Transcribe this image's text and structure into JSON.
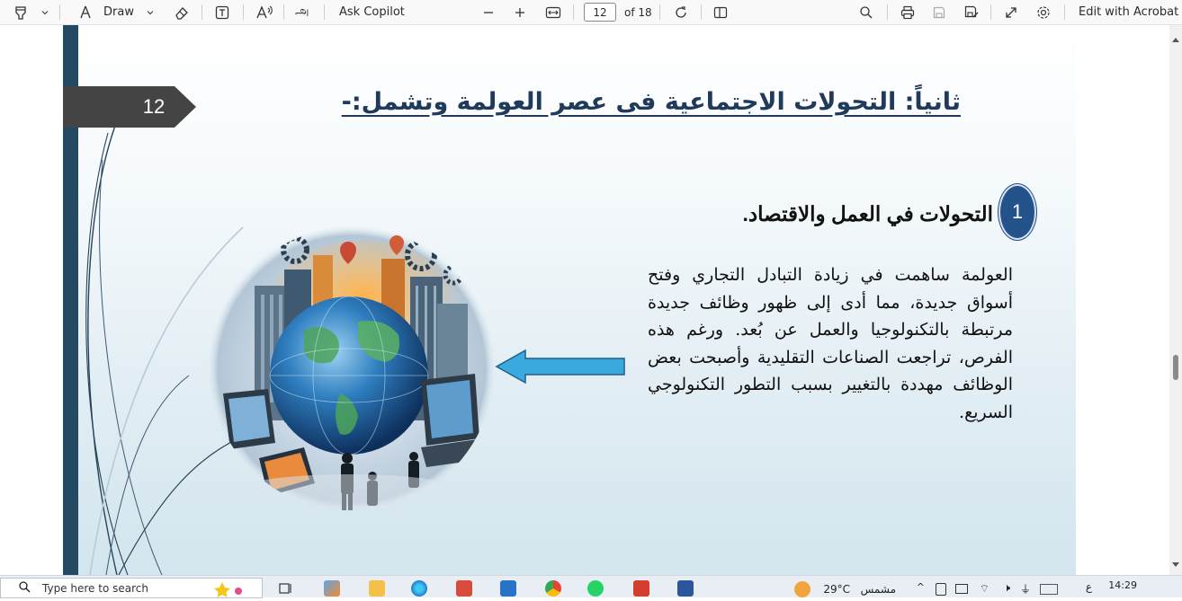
{
  "toolbar": {
    "draw_label": "Draw",
    "ask_copilot_label": "Ask Copilot",
    "page_current": "12",
    "page_total": "of 18",
    "edit_label": "Edit with Acrobat"
  },
  "slide": {
    "number": "12",
    "title": "ثانياً: التحولات الاجتماعية فى عصر العولمة وتشمل:-",
    "bullet_number": "1",
    "section_heading": "التحولات في العمل والاقتصاد.",
    "body": "العولمة ساهمت في زيادة التبادل التجاري وفتح أسواق جديدة، مما أدى إلى ظهور وظائف جديدة مرتبطة بالتكنولوجيا والعمل عن بُعد. ورغم هذه الفرص، تراجعت الصناعات التقليدية وأصبحت بعض الوظائف مهددة بالتغيير بسبب التطور التكنولوجي السريع."
  },
  "taskbar": {
    "search_placeholder": "Type here to search",
    "weather": "29°C",
    "weather_desc": "مشمس",
    "time": "14:29",
    "language": "ع"
  },
  "colors": {
    "slide_bar": "#244a63",
    "tag": "#444444",
    "title": "#1f3a5a",
    "bullet": "#24528a",
    "arrow": "#3aa9e0"
  },
  "icons": [
    "highlighter-icon",
    "draw-icon",
    "eraser-icon",
    "textbox-icon",
    "read-aloud-icon",
    "translate-icon",
    "zoom-out-icon",
    "zoom-in-icon",
    "fit-width-icon",
    "rotate-icon",
    "page-view-icon",
    "search-icon",
    "print-icon",
    "save-icon",
    "save-as-icon",
    "expand-icon",
    "settings-icon"
  ]
}
